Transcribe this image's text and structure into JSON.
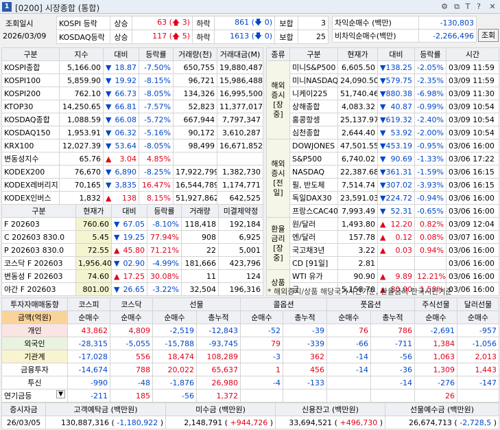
{
  "window": {
    "num": "1",
    "title": "[0200] 시장종합 (통합)"
  },
  "topbar": {
    "date_label": "조회일시",
    "date": "2026/03/09",
    "rows": [
      {
        "name": "KOSPI 등락",
        "up_lbl": "상승",
        "up": "63",
        "upper": "3",
        "dn_lbl": "하락",
        "dn": "861",
        "lower": "0",
        "flat_lbl": "보합",
        "flat": "3"
      },
      {
        "name": "KOSDAQ등락",
        "up_lbl": "상승",
        "up": "117",
        "upper": "5",
        "dn_lbl": "하락",
        "dn": "1613",
        "lower": "0",
        "flat_lbl": "보합",
        "flat": "25"
      }
    ],
    "arb": [
      {
        "label": "차익순매수  (백만)",
        "value": "-130,803"
      },
      {
        "label": "비차익순매수(백만)",
        "value": "-2,266,496"
      }
    ],
    "query_btn": "조회"
  },
  "idx": {
    "headers": [
      "구분",
      "지수",
      "대비",
      "등락률",
      "거래량(천)",
      "거래대금(M)"
    ],
    "rows": [
      [
        "KOSPI종합",
        "5,166.00",
        "dn",
        "18.87",
        "-7.50%",
        "650,755",
        "19,880,487"
      ],
      [
        "KOSPI100",
        "5,859.90",
        "dn",
        "19.92",
        "-8.15%",
        "96,721",
        "15,986,488"
      ],
      [
        "KOSPI200",
        "762.10",
        "dn",
        "66.73",
        "-8.05%",
        "134,326",
        "16,995,500"
      ],
      [
        "KTOP30",
        "14,250.65",
        "dn",
        "66.81",
        "-7.57%",
        "52,823",
        "11,377,017"
      ],
      [
        "KOSDAQ종합",
        "1,088.59",
        "dn",
        "66.08",
        "-5.72%",
        "667,944",
        "7,797,347"
      ],
      [
        "KOSDAQ150",
        "1,953.91",
        "dn",
        "06.32",
        "-5.16%",
        "90,172",
        "3,610,287"
      ],
      [
        "KRX100",
        "12,027.39",
        "dn",
        "53.64",
        "-8.05%",
        "98,499",
        "16,671,852"
      ],
      [
        "변동성지수",
        "65.76",
        "up",
        "3.04",
        "4.85%",
        "",
        ""
      ],
      [
        "KODEX200",
        "76,670",
        "dn",
        "6,890",
        "-8.25%",
        "17,922,799",
        "1,382,730"
      ],
      [
        "KODEX레버리지",
        "70,165",
        "dn",
        "3,835",
        "16.47%",
        "16,544,789",
        "1,174,771"
      ],
      [
        "KODEX인버스",
        "1,832",
        "up",
        "138",
        "8.15%",
        "51,927,862",
        "642,525"
      ]
    ]
  },
  "fut": {
    "headers": [
      "구분",
      "현재가",
      "대비",
      "등락률",
      "거래량",
      "미결제약정"
    ],
    "rows": [
      [
        "F 202603",
        "760.60",
        "dn",
        "67.05",
        "-8.10%",
        "118,418",
        "192,184"
      ],
      [
        "C 202603    830.0",
        "5.45",
        "dn",
        "19.25",
        "77.94%",
        "908",
        "6,925"
      ],
      [
        "P 202603    830.0",
        "72.55",
        "up",
        "45.80",
        "71.21%",
        "22",
        "5,001"
      ],
      [
        "코스닥 F 202603",
        "1,956.40",
        "dn",
        "02.90",
        "-4.99%",
        "181,666",
        "423,796"
      ],
      [
        "변동성 F 202603",
        "74.60",
        "up",
        "17.25",
        "30.08%",
        "11",
        "124"
      ],
      [
        "야간 F 202603",
        "801.00",
        "dn",
        "26.65",
        "-3.22%",
        "32,504",
        "196,316"
      ]
    ]
  },
  "world": {
    "headers": [
      "종류",
      "구분",
      "현재가",
      "대비",
      "등락률",
      "시간"
    ],
    "groups": [
      {
        "label": "해외증시[장중]",
        "rows": [
          [
            "미니S&P500",
            "6,605.50",
            "dn",
            "138.25",
            "-2.05%",
            "03/09 11:59"
          ],
          [
            "미니NASDAQ",
            "24,090.50",
            "dn",
            "579.75",
            "-2.35%",
            "03/09 11:59"
          ],
          [
            "니케이225",
            "51,740.46",
            "dn",
            "880.38",
            "-6.98%",
            "03/09 11:30"
          ],
          [
            "상해종합",
            "4,083.32",
            "dn",
            "40.87",
            "-0.99%",
            "03/09 10:54"
          ],
          [
            "홍콩항셍",
            "25,137.97",
            "dn",
            "619.32",
            "-2.40%",
            "03/09 10:54"
          ],
          [
            "심천종합",
            "2,644.40",
            "dn",
            "53.92",
            "-2.00%",
            "03/09 10:54"
          ]
        ]
      },
      {
        "label": "해외증시[전일]",
        "rows": [
          [
            "DOWJONES",
            "47,501.55",
            "dn",
            "453.19",
            "-0.95%",
            "03/06 16:00"
          ],
          [
            "S&P500",
            "6,740.02",
            "dn",
            "90.69",
            "-1.33%",
            "03/06 17:22"
          ],
          [
            "NASDAQ",
            "22,387.68",
            "dn",
            "361.31",
            "-1.59%",
            "03/06 16:15"
          ],
          [
            "필, 반도체",
            "7,514.74",
            "dn",
            "307.02",
            "-3.93%",
            "03/06 16:15"
          ],
          [
            "독일DAX30",
            "23,591.03",
            "dn",
            "224.72",
            "-0.94%",
            "03/06 16:00"
          ],
          [
            "프랑스CAC40",
            "7,993.49",
            "dn",
            "52.31",
            "-0.65%",
            "03/06 16:00"
          ]
        ]
      },
      {
        "label": "환율금리[장중]",
        "rows": [
          [
            "원/달러",
            "1,493.80",
            "up",
            "12.20",
            "0.82%",
            "03/09 12:04"
          ],
          [
            "엔/달러",
            "157.78",
            "up",
            "0.12",
            "0.08%",
            "03/07 16:00"
          ],
          [
            "국고채3년",
            "3.22",
            "up",
            "0.03",
            "0.94%",
            "03/06 16:00"
          ],
          [
            "CD [91일]",
            "2.81",
            "",
            "",
            "",
            "03/06 16:00"
          ]
        ]
      },
      {
        "label": "상품",
        "rows": [
          [
            "WTI 유가",
            "90.90",
            "up",
            "9.89",
            "12.21%",
            "03/06 16:00"
          ],
          [
            "금",
            "5,158.70",
            "up",
            "80.00",
            "1.58%",
            "03/06 16:00"
          ]
        ]
      }
    ],
    "note": "* 해외증시/상품 해당국가시간기준, 환율금리 한국시간기준"
  },
  "investor": {
    "title": "투자자매매동향",
    "groups": [
      "코스피",
      "코스닥",
      "선물",
      "콜옵션",
      "풋옵션",
      "주식선물",
      "달러선물"
    ],
    "amount_label": "금액(억원)",
    "subheaders": [
      "순매수",
      "순매수",
      "순매수",
      "총누적",
      "순매수",
      "총누적",
      "순매수",
      "총누적",
      "순매수",
      "순매수"
    ],
    "rows": [
      {
        "name": "개인",
        "cls": "pk",
        "v": [
          "43,862",
          "4,809",
          "-2,519",
          "-12,843",
          "-52",
          "-39",
          "76",
          "786",
          "-2,691",
          "-957"
        ]
      },
      {
        "name": "외국인",
        "cls": "gr",
        "v": [
          "-28,315",
          "-5,055",
          "-15,788",
          "-93,745",
          "79",
          "-339",
          "-66",
          "-711",
          "1,384",
          "-1,056"
        ]
      },
      {
        "name": "기관계",
        "cls": "yl",
        "v": [
          "-17,028",
          "556",
          "18,474",
          "108,289",
          "-3",
          "362",
          "-14",
          "-56",
          "1,063",
          "2,013"
        ]
      },
      {
        "name": "금융투자",
        "cls": "",
        "v": [
          "-14,674",
          "788",
          "20,022",
          "65,637",
          "1",
          "456",
          "-14",
          "-36",
          "1,309",
          "1,443"
        ]
      },
      {
        "name": "투신",
        "cls": "",
        "v": [
          "-990",
          "-48",
          "-1,876",
          "26,980",
          "-4",
          "-133",
          "",
          "-14",
          "-276",
          "-147"
        ]
      },
      {
        "name": "연기금등",
        "cls": "",
        "v": [
          "-211",
          "185",
          "-56",
          "1,372",
          "",
          "",
          "",
          "",
          "26",
          ""
        ]
      }
    ]
  },
  "funds": {
    "headers": [
      "증시자금",
      "고객예탁금 (백만원)",
      "미수금 (백만원)",
      "신용잔고 (백만원)",
      "선물예수금 (백만원)"
    ],
    "date": "26/03/05",
    "values": [
      {
        "v": "130,887,316",
        "d": "-1,180,922",
        "sign": "dn"
      },
      {
        "v": "2,148,791",
        "d": "+944,726",
        "sign": "up"
      },
      {
        "v": "33,694,521",
        "d": "+496,730",
        "sign": "up"
      },
      {
        "v": "26,674,713",
        "d": "-2,728,5",
        "sign": "dn"
      }
    ]
  },
  "colors": {
    "up": "#e0001a",
    "down": "#0046c8",
    "header": "#eef0f4",
    "orange": "#f9d49a"
  },
  "icons": [
    "window-number-icon",
    "settings-icon",
    "copy-icon",
    "tip-icon",
    "help-icon",
    "close-icon",
    "arrow-up-icon",
    "arrow-down-icon",
    "dropdown-icon"
  ]
}
